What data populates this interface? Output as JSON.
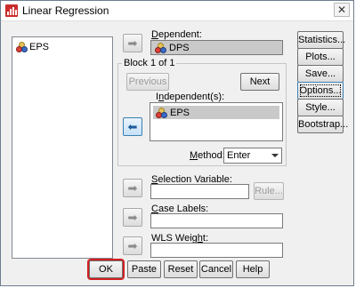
{
  "window": {
    "title": "Linear Regression",
    "close_glyph": "✕"
  },
  "source_list": {
    "items": [
      {
        "label": "EPS",
        "icon": "scale-variable-icon"
      }
    ]
  },
  "dependent": {
    "label_prefix": "",
    "label_mnemonic": "D",
    "label_rest": "ependent:",
    "value": "DPS"
  },
  "block": {
    "title": "Block 1 of 1",
    "previous_label": "Previous",
    "next_label": "Next",
    "independent_label_prefix": "I",
    "independent_label_mnemonic": "n",
    "independent_label_rest": "dependent(s):",
    "independent_items": [
      {
        "label": "EPS"
      }
    ],
    "method_label_mnemonic": "M",
    "method_label_rest": "ethod:",
    "method_value": "Enter"
  },
  "selection": {
    "label_mnemonic": "S",
    "label_rest": "election Variable:",
    "rule_label": "Rule..."
  },
  "case_labels": {
    "label_mnemonic": "C",
    "label_rest": "ase Labels:"
  },
  "wls": {
    "label_prefix": "WLS Weig",
    "label_mnemonic": "h",
    "label_rest": "t:"
  },
  "side_buttons": [
    {
      "name": "statistics-button",
      "label": "Statistics..."
    },
    {
      "name": "plots-button",
      "label": "Plots..."
    },
    {
      "name": "save-button",
      "label": "Save..."
    },
    {
      "name": "options-button",
      "label": "Options..."
    },
    {
      "name": "style-button",
      "label": "Style..."
    },
    {
      "name": "bootstrap-button",
      "label": "Bootstrap..."
    }
  ],
  "footer": {
    "ok": "OK",
    "paste": "Paste",
    "reset": "Reset",
    "cancel": "Cancel",
    "help": "Help"
  },
  "colors": {
    "ok_highlight": "#d21f1f",
    "selected_bg": "#c9c9c9"
  }
}
